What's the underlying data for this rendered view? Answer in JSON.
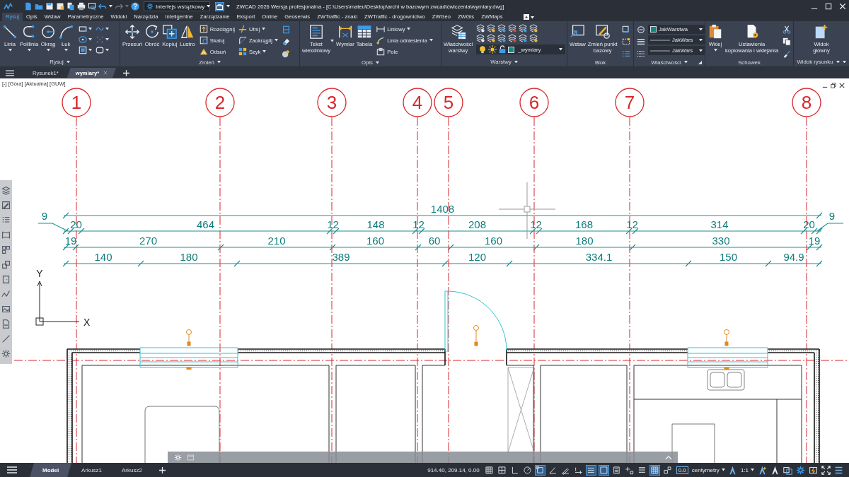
{
  "title_bar": {
    "workspace": "Interfejs wstążkowy",
    "title": "ZWCAD 2026 Wersja profesjonalna - [C:\\Users\\mateu\\Desktop\\archi w bazowym zwcad\\ćwiczenia\\wymiary.dwg]"
  },
  "ribbon": {
    "tabs": [
      {
        "label": "Rysuj",
        "selected": true
      },
      {
        "label": "Opis",
        "selected": false
      },
      {
        "label": "Wstaw",
        "selected": false
      },
      {
        "label": "Parametryczne",
        "selected": false
      },
      {
        "label": "Widoki",
        "selected": false
      },
      {
        "label": "Narzędzia",
        "selected": false
      },
      {
        "label": "Inteligentne",
        "selected": false
      },
      {
        "label": "Zarządzanie",
        "selected": false
      },
      {
        "label": "Eksport",
        "selected": false
      },
      {
        "label": "Online",
        "selected": false
      },
      {
        "label": "Geoserwis",
        "selected": false
      },
      {
        "label": "ZWTraffic - znaki",
        "selected": false
      },
      {
        "label": "ZWTraffic - drogownictwo",
        "selected": false
      },
      {
        "label": "ZWGeo",
        "selected": false
      },
      {
        "label": "ZWGis",
        "selected": false
      },
      {
        "label": "ZWMaps",
        "selected": false
      }
    ],
    "panels": [
      {
        "title": "Rysuj",
        "tools": [
          "Linia",
          "Polilinia",
          "Okrąg",
          "Łuk"
        ]
      },
      {
        "title": "Zmień",
        "tools": [
          "Przesuń",
          "Obróć",
          "Kopiuj",
          "Lustro",
          "Rozciągnij",
          "Skaluj",
          "Odsuń",
          "Utnij",
          "Zaokrąglij",
          "Szyk"
        ]
      },
      {
        "title": "Opis",
        "tools": [
          "Tekst\nwieloliniowy",
          "Wymiar",
          "Tabela",
          "Liniowy",
          "Linia odniesienia",
          "Pole"
        ]
      },
      {
        "title": "Warstwy",
        "tools": [
          "Właściwości\nwarstwy"
        ],
        "current_layer": "_wymiary"
      },
      {
        "title": "Blok",
        "tools": [
          "Wstaw",
          "Zmień punkt\nbazowy"
        ]
      },
      {
        "title": "Właściwości",
        "dropdowns": [
          "JakWarstwa",
          "JakWars",
          "JakWars"
        ]
      },
      {
        "title": "Schowek",
        "tools": [
          "Wklej",
          "Ustawienia\nkopiowania i wklejania"
        ]
      },
      {
        "title": "Widok rysunku",
        "tools": [
          "Widok\ngłówny"
        ]
      }
    ]
  },
  "file_tabs": [
    {
      "label": "Rysunek1*",
      "selected": false
    },
    {
      "label": "wymiary*",
      "selected": true
    }
  ],
  "viewport_label": "[-] [Góra] [Aktualna] [GUW]",
  "drawing": {
    "axes": [
      "1",
      "2",
      "3",
      "4",
      "5",
      "6",
      "7",
      "8"
    ],
    "dimension_rows": [
      [
        "1408"
      ],
      [
        "9",
        "20",
        "464",
        "12",
        "148",
        "12",
        "208",
        "12",
        "168",
        "12",
        "314",
        "20",
        "9"
      ],
      [
        "19",
        "270",
        "210",
        "160",
        "60",
        "160",
        "180",
        "330",
        "19"
      ],
      [
        "140",
        "180",
        "389",
        "120",
        "334.1",
        "150",
        "94.9"
      ]
    ],
    "ucs": {
      "x_label": "X",
      "y_label": "Y"
    }
  },
  "layout_tabs": [
    {
      "label": "Model",
      "selected": true
    },
    {
      "label": "Arkusz1",
      "selected": false
    },
    {
      "label": "Arkusz2",
      "selected": false
    }
  ],
  "status_bar": {
    "coordinates": "914.40, 209.14, 0.00",
    "toggles": [
      {
        "on": false
      },
      {
        "on": false
      },
      {
        "on": false
      },
      {
        "on": false
      },
      {
        "on": true
      },
      {
        "on": false
      },
      {
        "on": false
      },
      {
        "on": false
      },
      {
        "on": true
      },
      {
        "on": true
      },
      {
        "on": false
      },
      {
        "on": false
      },
      {
        "on": false
      },
      {
        "on": true
      },
      {
        "on": false
      }
    ],
    "value_box": "0.0",
    "units": "centymetry",
    "annotation_scale": "1:1"
  }
}
